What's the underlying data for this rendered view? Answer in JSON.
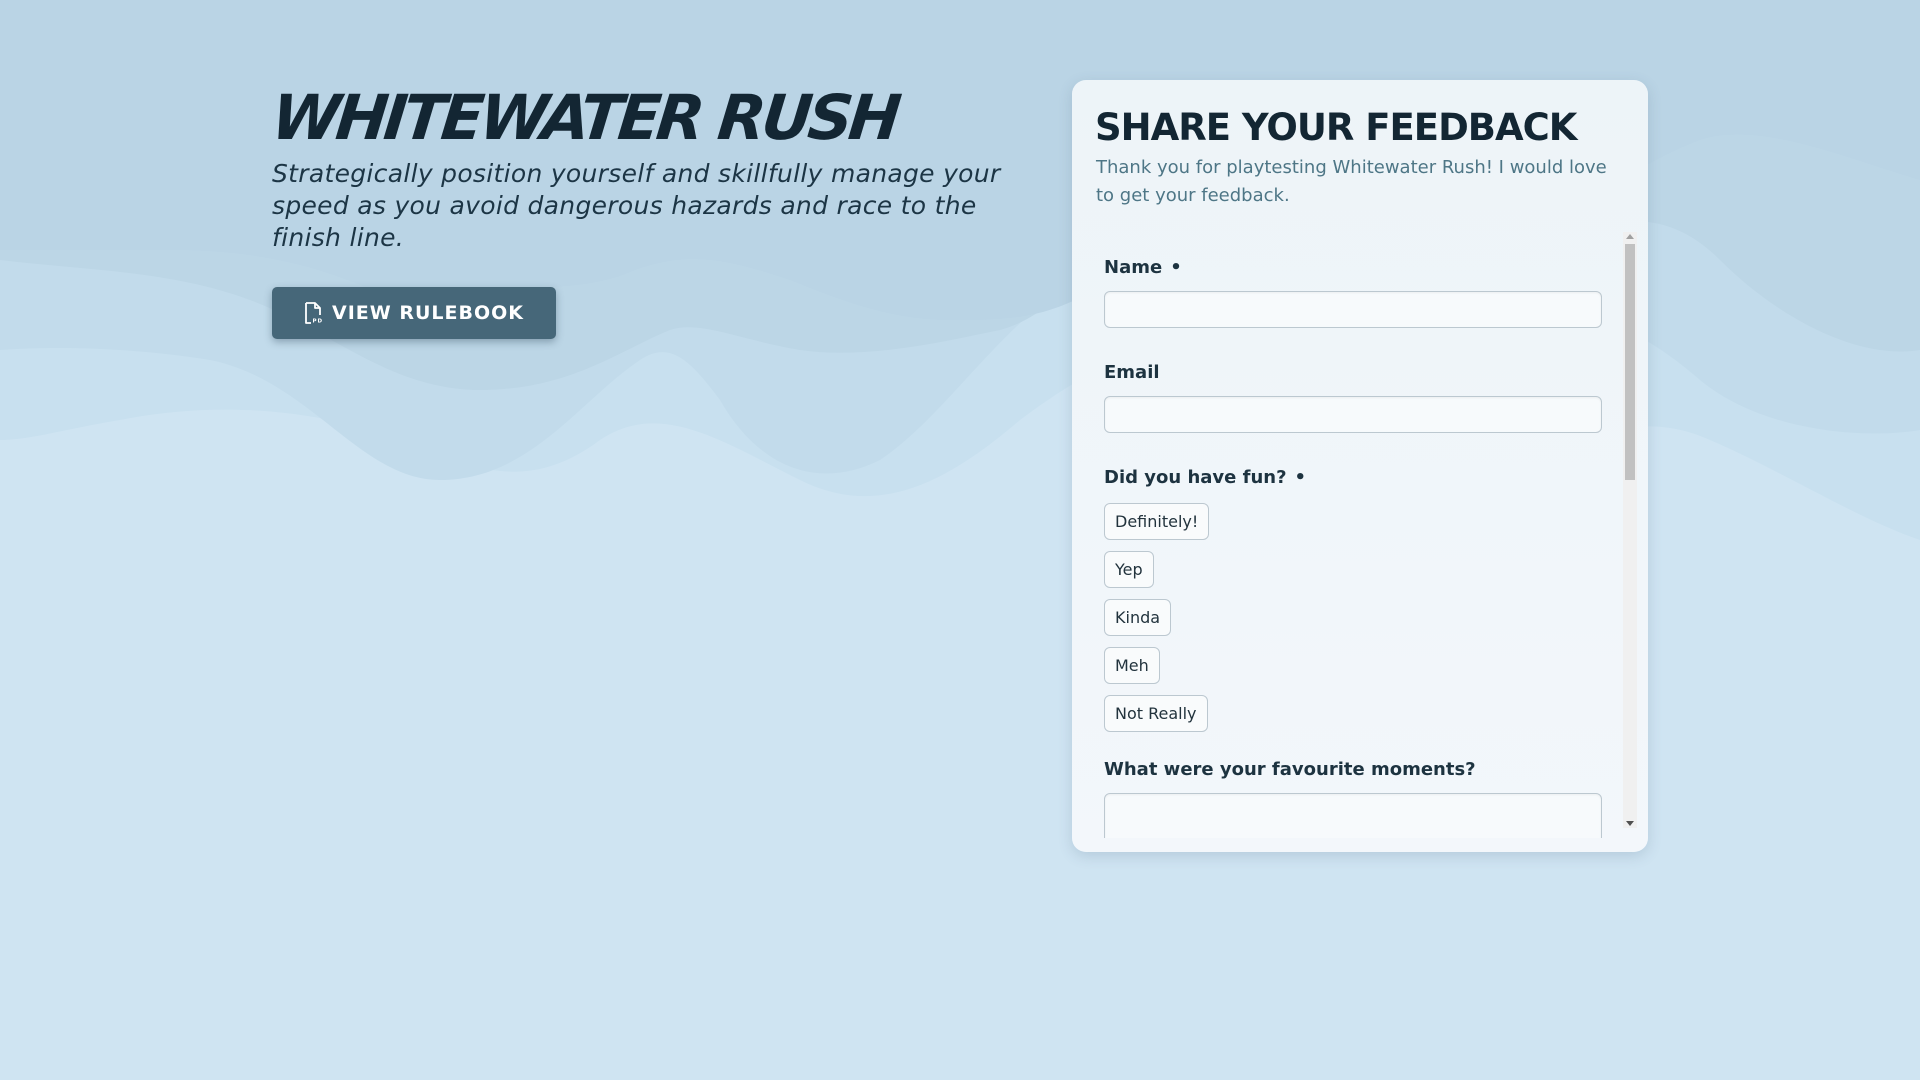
{
  "hero": {
    "title": "WHITEWATER RUSH",
    "subtitle": "Strategically position yourself and skillfully manage your speed as you avoid dangerous hazards and race to the finish line.",
    "rulebook_button": {
      "label": "VIEW RULEBOOK",
      "icon": "pdf-file-icon"
    }
  },
  "feedback": {
    "title": "SHARE YOUR FEEDBACK",
    "description": "Thank you for playtesting Whitewater Rush! I would love to get your feedback.",
    "fields": {
      "name": {
        "label": "Name",
        "required_mark": "•",
        "value": ""
      },
      "email": {
        "label": "Email",
        "value": ""
      },
      "fun": {
        "label": "Did you have fun?",
        "required_mark": "•",
        "options": [
          "Definitely!",
          "Yep",
          "Kinda",
          "Meh",
          "Not Really"
        ]
      },
      "moments": {
        "label": "What were your favourite moments?",
        "value": ""
      }
    }
  },
  "colors": {
    "background": "#cfe4f2",
    "title_text": "#132633",
    "button_bg": "#466779",
    "panel_bg": "#f3f7fb",
    "description_text": "#4e7686"
  }
}
